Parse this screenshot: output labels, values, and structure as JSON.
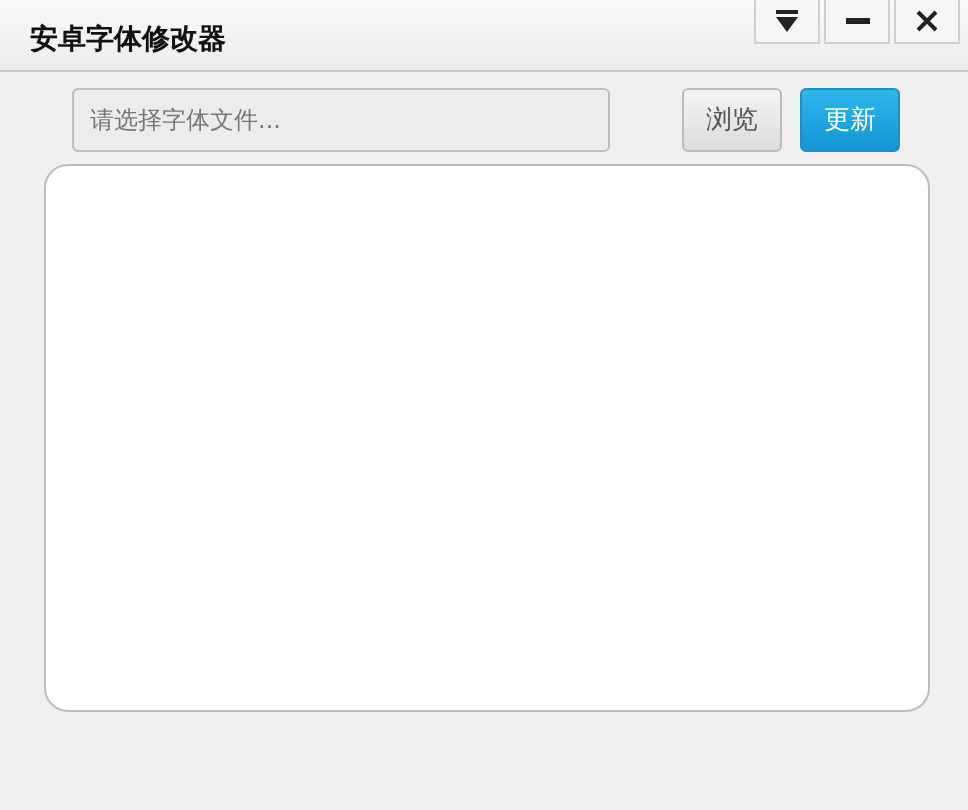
{
  "window": {
    "title": "安卓字体修改器"
  },
  "file_field": {
    "placeholder": "请选择字体文件..."
  },
  "buttons": [
    {
      "label": "浏览",
      "kind": "default"
    },
    {
      "label": "更新",
      "kind": "primary"
    }
  ]
}
